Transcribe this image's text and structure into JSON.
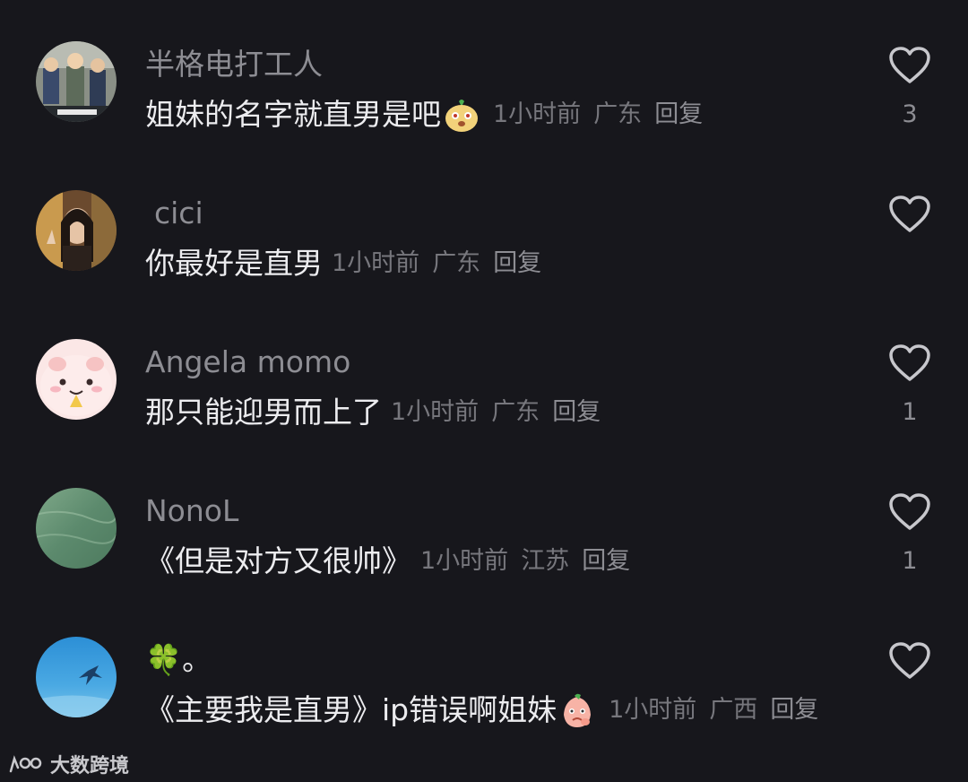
{
  "comments": [
    {
      "username": "半格电打工人",
      "text": "姐妹的名字就直男是吧",
      "emoji": "melon-face-emoji",
      "time": "1小时前",
      "location": "广东",
      "reply_label": "回复",
      "likes": "3",
      "avatar": "cartoon-office-avatar"
    },
    {
      "username": "cici",
      "text": "你最好是直男",
      "emoji": "",
      "time": "1小时前",
      "location": "广东",
      "reply_label": "回复",
      "likes": "",
      "avatar": "girl-photo-avatar"
    },
    {
      "username": "Angela momo",
      "text": "那只能迎男而上了",
      "emoji": "",
      "time": "1小时前",
      "location": "广东",
      "reply_label": "回复",
      "likes": "1",
      "avatar": "pink-pig-avatar"
    },
    {
      "username": "NonoL",
      "text": "《但是对方又很帅》",
      "emoji": "",
      "time": "1小时前",
      "location": "江苏",
      "reply_label": "回复",
      "likes": "1",
      "avatar": "green-water-avatar"
    },
    {
      "username": "🍀。",
      "text": "《主要我是直男》ip错误啊姐妹",
      "emoji": "peach-thinking-emoji",
      "time": "1小时前",
      "location": "广西",
      "reply_label": "回复",
      "likes": "",
      "avatar": "blue-sky-bird-avatar"
    }
  ],
  "watermark": {
    "text": "大数跨境"
  },
  "colors": {
    "background": "#17171c",
    "username": "#8d8d93",
    "text": "#ececef",
    "meta": "#77777d"
  }
}
